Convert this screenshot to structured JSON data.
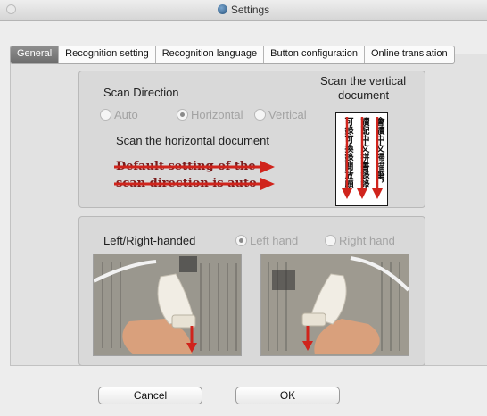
{
  "window": {
    "title": "Settings"
  },
  "tabs": [
    "General",
    "Recognition setting",
    "Recognition language",
    "Button configuration",
    "Online translation"
  ],
  "active_tab": "General",
  "scan_direction": {
    "heading": "Scan Direction",
    "options": [
      "Auto",
      "Horizontal",
      "Vertical"
    ],
    "selected": "Horizontal",
    "horizontal_caption": "Scan the horizontal document",
    "vertical_caption_line1": "Scan the vertical",
    "vertical_caption_line2": "document",
    "demo_line1": "Default setting of  the",
    "demo_line2": "scan direction is auto",
    "vertical_doc_text": [
      "可錄可換錄閱放頗",
      "讀配中文拼書錄錄",
      "會讀中文掃描筆，"
    ]
  },
  "handedness": {
    "heading": "Left/Right-handed",
    "options": [
      "Left hand",
      "Right hand"
    ],
    "selected": "Left hand"
  },
  "buttons": {
    "cancel": "Cancel",
    "ok": "OK"
  },
  "colors": {
    "arrow": "#d0241c",
    "selected_tab": "#7a7a7a"
  }
}
